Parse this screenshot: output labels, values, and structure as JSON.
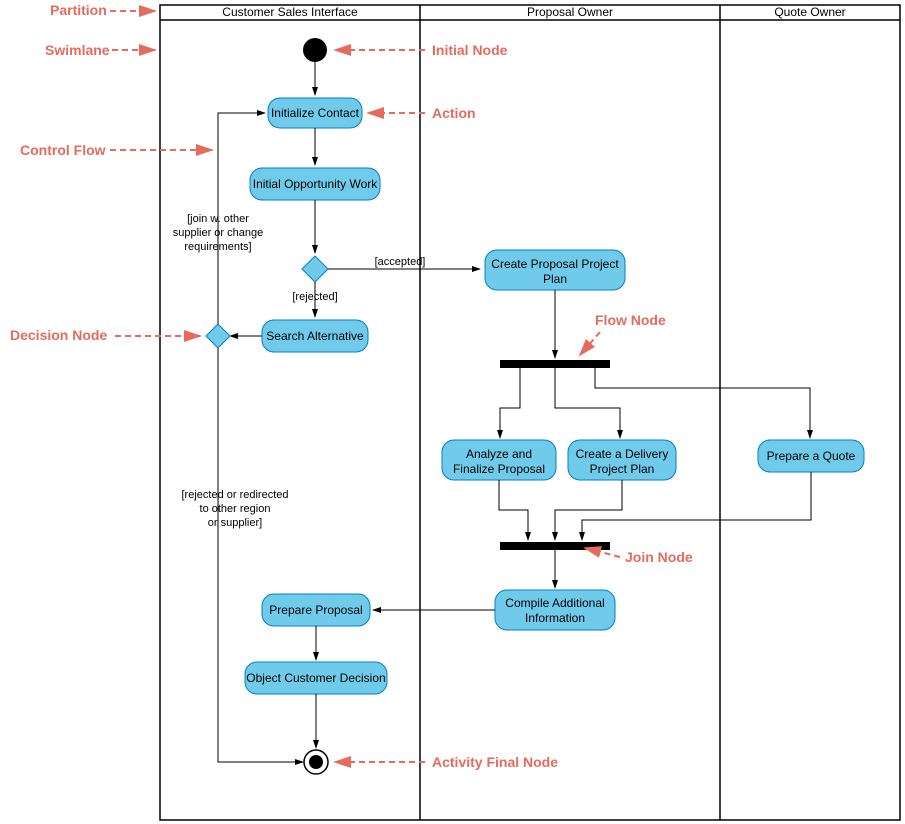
{
  "lanes": {
    "l1": "Customer Sales Interface",
    "l2": "Proposal Owner",
    "l3": "Quote Owner"
  },
  "actions": {
    "initContact": "Initialize Contact",
    "initOpp": "Initial Opportunity Work",
    "searchAlt": "Search Alternative",
    "createPlan1": "Create Proposal Project",
    "createPlan2": "Plan",
    "analyze1": "Analyze and",
    "analyze2": "Finalize Proposal",
    "delivery1": "Create a Delivery",
    "delivery2": "Project Plan",
    "quote": "Prepare a Quote",
    "compile1": "Compile Additional",
    "compile2": "Information",
    "prepare": "Prepare Proposal",
    "object": "Object Customer Decision"
  },
  "guards": {
    "accepted": "[accepted]",
    "rejected": "[rejected]",
    "join1": "[join w. other",
    "join2": "supplier or change",
    "join3": "requirements]",
    "redir1": "[rejected or redirected",
    "redir2": "to other region",
    "redir3": "or supplier]"
  },
  "annotations": {
    "partition": "Partition",
    "swimlane": "Swimlane",
    "controlFlow": "Control Flow",
    "decisionNode": "Decision Node",
    "initialNode": "Initial Node",
    "action": "Action",
    "flowNode": "Flow Node",
    "joinNode": "Join Node",
    "finalNode": "Activity Final Node"
  },
  "colors": {
    "nodeFill": "#70CBEB",
    "nodeStroke": "#0080C0",
    "annot": "#E56B5E"
  }
}
